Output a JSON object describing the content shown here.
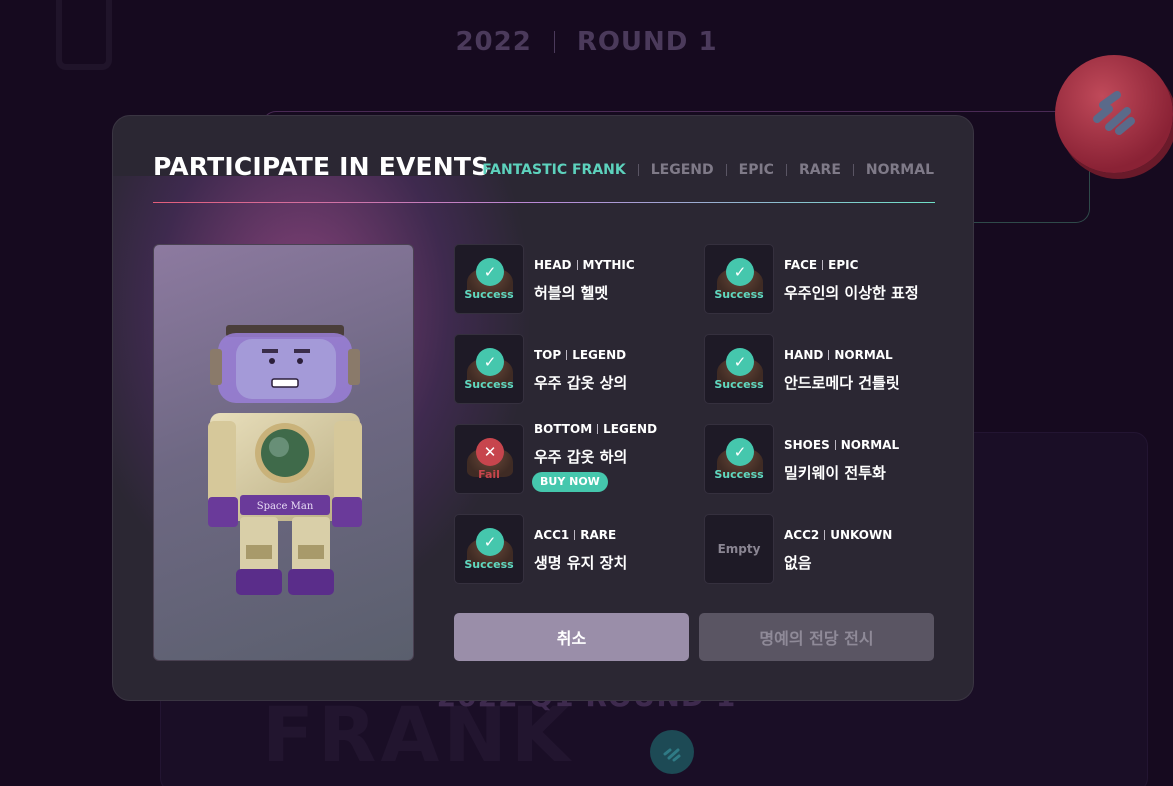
{
  "background": {
    "year": "2022",
    "round": "ROUND 1",
    "quarter_round": "2022 Q1 ROUND 1",
    "frank_text": "FRANK"
  },
  "modal": {
    "title": "PARTICIPATE IN EVENTS",
    "tabs": [
      {
        "label": "FANTASTIC FRANK",
        "active": true
      },
      {
        "label": "LEGEND",
        "active": false
      },
      {
        "label": "EPIC",
        "active": false
      },
      {
        "label": "RARE",
        "active": false
      },
      {
        "label": "NORMAL",
        "active": false
      }
    ],
    "character": {
      "chest_label": "Space Man"
    },
    "items": [
      {
        "slot": "HEAD",
        "grade": "MYTHIC",
        "name": "허블의 헬멧",
        "status": "Success"
      },
      {
        "slot": "FACE",
        "grade": "EPIC",
        "name": "우주인의 이상한 표정",
        "status": "Success"
      },
      {
        "slot": "TOP",
        "grade": "LEGEND",
        "name": "우주 갑옷 상의",
        "status": "Success"
      },
      {
        "slot": "HAND",
        "grade": "NORMAL",
        "name": "안드로메다 건틀릿",
        "status": "Success"
      },
      {
        "slot": "BOTTOM",
        "grade": "LEGEND",
        "name": "우주 갑옷 하의",
        "status": "Fail",
        "buy_label": "BUY NOW"
      },
      {
        "slot": "SHOES",
        "grade": "NORMAL",
        "name": "밀키웨이 전투화",
        "status": "Success"
      },
      {
        "slot": "ACC1",
        "grade": "RARE",
        "name": "생명 유지 장치",
        "status": "Success"
      },
      {
        "slot": "ACC2",
        "grade": "UNKOWN",
        "name": "없음",
        "status": "Empty"
      }
    ],
    "buttons": {
      "cancel": "취소",
      "hall_of_fame": "명예의 전당 전시"
    }
  },
  "colors": {
    "accent": "#45c7ad",
    "fail": "#c7454d",
    "modal_bg": "#2b2733"
  }
}
